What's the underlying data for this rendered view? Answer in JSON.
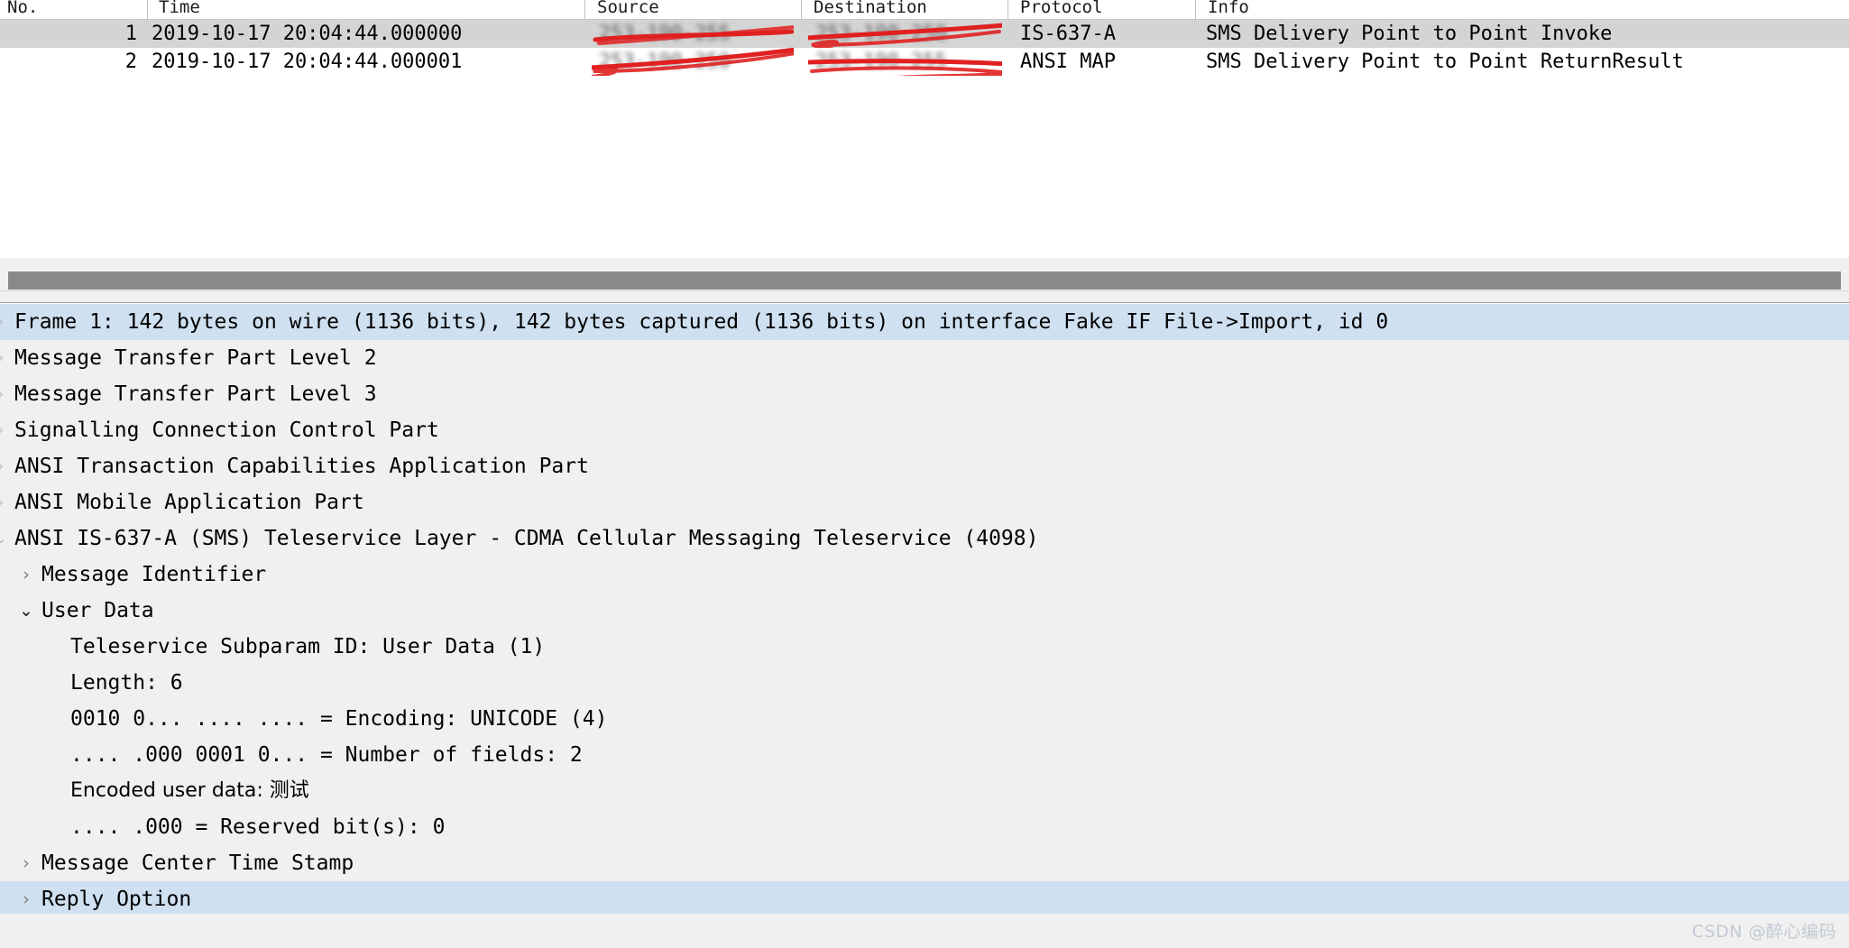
{
  "packet_list": {
    "columns": [
      {
        "key": "no",
        "label": "No."
      },
      {
        "key": "time",
        "label": "Time"
      },
      {
        "key": "source",
        "label": "Source"
      },
      {
        "key": "dest",
        "label": "Destination"
      },
      {
        "key": "protocol",
        "label": "Protocol"
      },
      {
        "key": "info",
        "label": "Info"
      }
    ],
    "rows": [
      {
        "no": "1",
        "time": "2019-10-17 20:04:44.000000",
        "source": "253-190-255",
        "dest": "253-190-250",
        "protocol": "IS-637-A",
        "info": "SMS Delivery Point to Point Invoke",
        "selected": true,
        "redacted": true
      },
      {
        "no": "2",
        "time": "2019-10-17 20:04:44.000001",
        "source": "253-190-250",
        "dest": "253-190-255",
        "protocol": "ANSI MAP",
        "info": "SMS Delivery Point to Point ReturnResult",
        "selected": false,
        "redacted": true
      }
    ]
  },
  "detail_tree": [
    {
      "level": 0,
      "twisty": "clipped-collapsed",
      "text": "Frame 1: 142 bytes on wire (1136 bits), 142 bytes captured (1136 bits) on interface Fake IF File->Import, id 0",
      "selected": true
    },
    {
      "level": 0,
      "twisty": "clipped-collapsed",
      "text": "Message Transfer Part Level 2",
      "selected": false
    },
    {
      "level": 0,
      "twisty": "clipped-collapsed",
      "text": "Message Transfer Part Level 3",
      "selected": false
    },
    {
      "level": 0,
      "twisty": "clipped-collapsed",
      "text": "Signalling Connection Control Part",
      "selected": false
    },
    {
      "level": 0,
      "twisty": "clipped-collapsed",
      "text": "ANSI Transaction Capabilities Application Part",
      "selected": false
    },
    {
      "level": 0,
      "twisty": "clipped-collapsed",
      "text": "ANSI Mobile Application Part",
      "selected": false
    },
    {
      "level": 0,
      "twisty": "clipped-expanded",
      "text": "ANSI IS-637-A (SMS) Teleservice Layer - CDMA Cellular Messaging Teleservice (4098)",
      "selected": false
    },
    {
      "level": 1,
      "twisty": "collapsed",
      "text": "Message Identifier",
      "selected": false
    },
    {
      "level": 1,
      "twisty": "expanded",
      "text": "User Data",
      "selected": false
    },
    {
      "level": 2,
      "twisty": "none",
      "text": "Teleservice Subparam ID: User Data (1)",
      "selected": false
    },
    {
      "level": 2,
      "twisty": "none",
      "text": "Length: 6",
      "selected": false
    },
    {
      "level": 2,
      "twisty": "none",
      "text": "0010 0... .... .... = Encoding: UNICODE (4)",
      "selected": false
    },
    {
      "level": 2,
      "twisty": "none",
      "text": ".... .000 0001 0... = Number of fields: 2",
      "selected": false
    },
    {
      "level": 2,
      "twisty": "none",
      "text": "Encoded user data: 测试",
      "selected": false
    },
    {
      "level": 2,
      "twisty": "none",
      "text": ".... .000 = Reserved bit(s): 0",
      "selected": false
    },
    {
      "level": 1,
      "twisty": "collapsed",
      "text": "Message Center Time Stamp",
      "selected": false
    },
    {
      "level": 1,
      "twisty": "collapsed",
      "text": "Reply Option",
      "selected": true
    }
  ],
  "scrollbar": {
    "orientation": "horizontal",
    "thumb_position": "full"
  },
  "watermark": {
    "text": "CSDN @醉心编码"
  },
  "colors": {
    "selection_row": "#d4d4d4",
    "selection_tree": "#cfe0f0",
    "detail_background": "#f0f0f0",
    "scrollbar_thumb": "#8a8a8a",
    "redaction_mark": "#e02020",
    "watermark": "#c3c9d4"
  },
  "glyphs": {
    "collapsed": "›",
    "expanded": "⌄"
  }
}
